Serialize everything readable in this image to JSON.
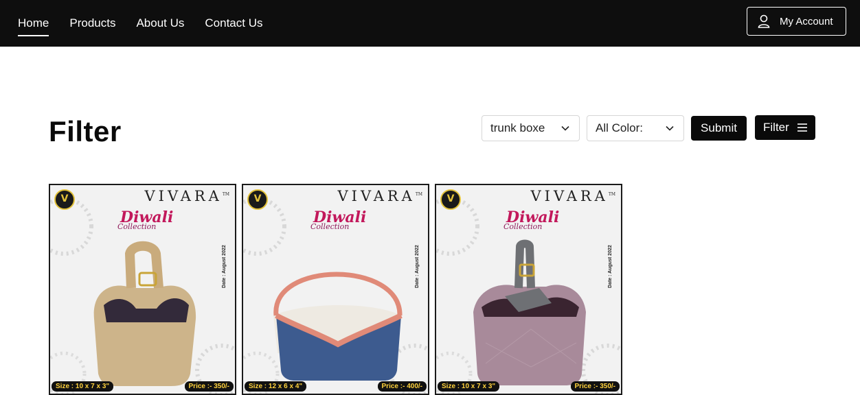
{
  "nav": {
    "links": [
      {
        "label": "Home",
        "active": true
      },
      {
        "label": "Products",
        "active": false
      },
      {
        "label": "About Us",
        "active": false
      },
      {
        "label": "Contact Us",
        "active": false
      }
    ],
    "account_label": "My Account"
  },
  "filter": {
    "title": "Filter",
    "category_value": "trunk boxe",
    "color_value": "All Color:",
    "submit_label": "Submit",
    "filter_label": "Filter"
  },
  "products": [
    {
      "brand": "VIVARA",
      "collection_title": "Diwali",
      "collection_sub": "Collection",
      "date": "Date : August 2022",
      "size": "Size : 10 x 7 x 3\"",
      "price": "Price :- 350/-",
      "color": "#cdb48a",
      "handle_color": "#c9ab7c"
    },
    {
      "brand": "VIVARA",
      "collection_title": "Diwali",
      "collection_sub": "Collection",
      "date": "Date : August 2022",
      "size": "Size : 12 x 6 x 4\"",
      "price": "Price :- 400/-",
      "color": "#3d5b8f",
      "handle_color": "#e08a78"
    },
    {
      "brand": "VIVARA",
      "collection_title": "Diwali",
      "collection_sub": "Collection",
      "date": "Date : August 2022",
      "size": "Size : 10 x 7 x 3\"",
      "price": "Price :- 350/-",
      "color": "#a88a9a",
      "handle_color": "#6e7074"
    }
  ],
  "colors": {
    "nav_bg": "#0e0e0e",
    "button_bg": "#0a0a0a",
    "price_tag_text": "#ffd23d"
  }
}
